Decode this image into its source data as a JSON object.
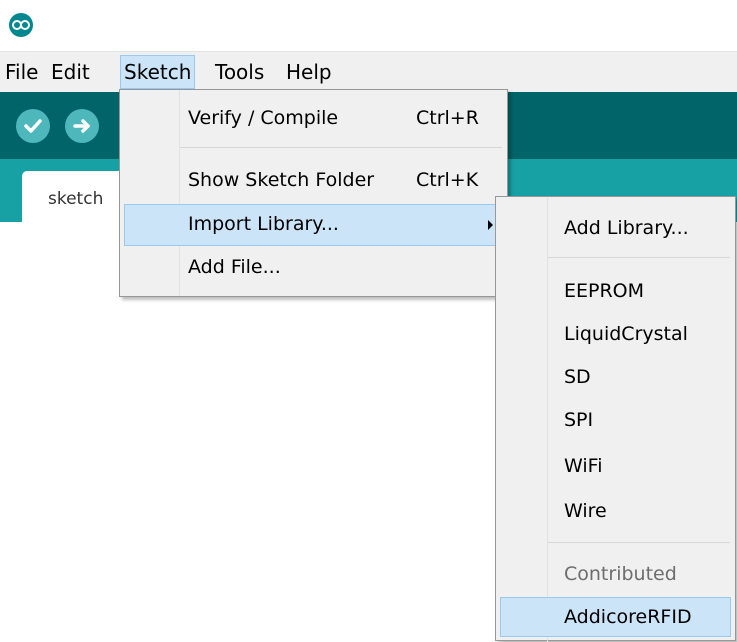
{
  "menubar": {
    "file": "File",
    "edit": "Edit",
    "sketch": "Sketch",
    "tools": "Tools",
    "help": "Help"
  },
  "editor": {
    "tab_label": "sketch"
  },
  "sketch_menu": {
    "items": [
      {
        "label": "Verify / Compile",
        "shortcut": "Ctrl+R"
      },
      {
        "label": "Show Sketch Folder",
        "shortcut": "Ctrl+K"
      },
      {
        "label": "Import Library...",
        "shortcut": ""
      },
      {
        "label": "Add File...",
        "shortcut": ""
      }
    ]
  },
  "import_library_menu": {
    "add_library": "Add Library...",
    "libraries": [
      "EEPROM",
      "LiquidCrystal",
      "SD",
      "SPI",
      "WiFi",
      "Wire"
    ],
    "contributed_header": "Contributed",
    "contributed": [
      "AddicoreRFID"
    ]
  },
  "icons": {
    "app": "arduino-logo-icon",
    "verify": "checkmark-icon",
    "upload": "arrow-right-icon",
    "submenu": "triangle-right-icon"
  },
  "colors": {
    "toolbar": "#006468",
    "tabstrip": "#17a1a5",
    "tool_button": "#4db7bb",
    "menu_highlight": "#cce4f7",
    "menu_background": "#f0f0f0"
  }
}
